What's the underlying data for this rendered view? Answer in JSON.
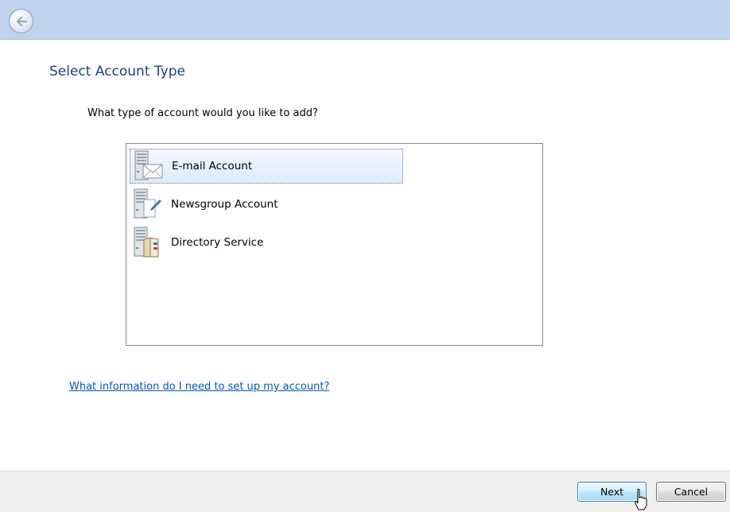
{
  "header": {
    "back_icon": "back-arrow-icon"
  },
  "main": {
    "title": "Select Account Type",
    "question": "What type of account would you like to add?",
    "account_types": [
      {
        "label": "E-mail Account",
        "icon": "email-server-icon",
        "selected": true
      },
      {
        "label": "Newsgroup Account",
        "icon": "newsgroup-server-icon",
        "selected": false
      },
      {
        "label": "Directory Service",
        "icon": "directory-server-icon",
        "selected": false
      }
    ],
    "help_link": "What information do I need to set up my account?"
  },
  "footer": {
    "next_label": "Next",
    "cancel_label": "Cancel"
  },
  "colors": {
    "banner": "#bfd3ec",
    "title": "#1e3c96",
    "link": "#0055cc",
    "footer": "#f0f0f0"
  }
}
